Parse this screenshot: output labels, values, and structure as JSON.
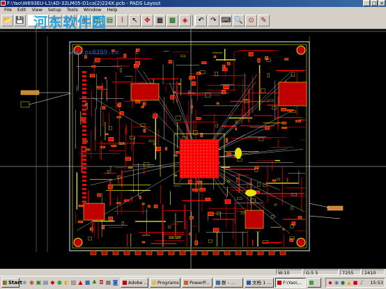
{
  "window": {
    "title": "F:\\Yao\\W693EU-L1\\4D-32LM05-D1ca(2)224X.pcb - PADS Layout",
    "controls": {
      "minimize": "_",
      "maximize": "□",
      "close": "×"
    }
  },
  "menu": [
    "File",
    "Edit",
    "View",
    "Setup",
    "Tools",
    "Window",
    "Help"
  ],
  "toolbar": {
    "buttons": [
      "open-icon",
      "save-icon",
      "layer-select",
      "undo-icon",
      "redo-icon",
      "zoom-icon",
      "drafting-icon",
      "design-icon",
      "route-icon",
      "select-icon",
      "pan-icon",
      "redraw-icon",
      "design-rules-icon",
      "settings-icon",
      "verify-icon",
      "cam-icon",
      "properties-icon",
      "undo-icon",
      "redo-icon",
      "help-icon",
      "find-icon",
      "zoom-in-icon",
      "tool-icon"
    ]
  },
  "watermark": {
    "main": "河东软件园",
    "url": "www.pc0359.cn"
  },
  "board": {
    "silk_labels": [
      "SDA",
      "SOCSEP",
      "P"
    ],
    "accent_colors": {
      "copper": "#ff0000",
      "silkscreen": "#e6e600",
      "outline": "#ffffff",
      "pad": "#c00000"
    }
  },
  "statusbar": {
    "w": "W:10",
    "g": "G:5 5",
    "x": "7255",
    "y": "2410"
  },
  "taskbar": {
    "start": "Start",
    "tasks": [
      {
        "label": "Adobe ...",
        "icon_color": "#c00000"
      },
      {
        "label": "Programs",
        "icon_color": "#e0c040"
      },
      {
        "label": "PowerP...",
        "icon_color": "#d0602a"
      },
      {
        "label": "群 - ...",
        "icon_color": "#3a6ea5"
      },
      {
        "label": "文档 1 ...",
        "icon_color": "#2a5aa5"
      },
      {
        "label": "F:\\Yao\\...",
        "icon_color": "#c00000",
        "active": true
      },
      {
        "label": "",
        "icon_color": "#40a040"
      }
    ],
    "clock": "15:53"
  }
}
